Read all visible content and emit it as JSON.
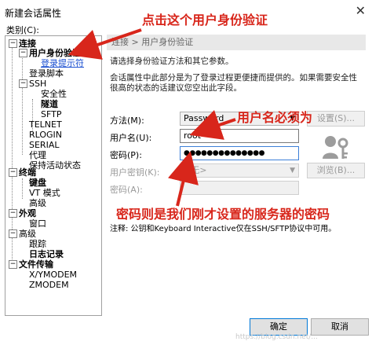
{
  "window": {
    "title": "新建会话属性",
    "close": "✕"
  },
  "tree": {
    "label": "类别(C):",
    "items": [
      {
        "label": "连接",
        "bold": true
      },
      {
        "label": "用户身份验证",
        "bold": true
      },
      {
        "label": "登录提示符",
        "link": true
      },
      {
        "label": "登录脚本"
      },
      {
        "label": "SSH"
      },
      {
        "label": "安全性"
      },
      {
        "label": "隧道",
        "bold": true
      },
      {
        "label": "SFTP"
      },
      {
        "label": "TELNET"
      },
      {
        "label": "RLOGIN"
      },
      {
        "label": "SERIAL"
      },
      {
        "label": "代理"
      },
      {
        "label": "保持活动状态"
      },
      {
        "label": "终端",
        "bold": true
      },
      {
        "label": "键盘",
        "bold": true
      },
      {
        "label": "VT 模式"
      },
      {
        "label": "高级"
      },
      {
        "label": "外观",
        "bold": true
      },
      {
        "label": "窗口"
      },
      {
        "label": "高级"
      },
      {
        "label": "跟踪"
      },
      {
        "label": "日志记录",
        "bold": true
      },
      {
        "label": "文件传输",
        "bold": true
      },
      {
        "label": "X/YMODEM"
      },
      {
        "label": "ZMODEM"
      }
    ]
  },
  "panel": {
    "breadcrumb": "连接 > 用户身份验证",
    "desc1": "请选择身份验证方法和其它参数。",
    "desc2": "会话属性中此部分是为了登录过程更便捷而提供的。如果需要安全性",
    "desc3": "很高的状态的话建议您空出此字段。",
    "method_label": "方法(M):",
    "method_value": "Password",
    "settings_button": "设置(S)...",
    "username_label": "用户名(U):",
    "username_value": "root",
    "password_label": "密码(P):",
    "password_value": "●●●●●●●●●●●●●●",
    "userkey_label": "用户密钥(K):",
    "userkey_value": "<无>",
    "browse_button": "浏览(B)...",
    "passphrase_label": "密码(A):",
    "note": "注释: 公钥和Keyboard Interactive仅在SSH/SFTP协议中可用。"
  },
  "buttons": {
    "ok": "确定",
    "cancel": "取消"
  },
  "annotations": {
    "top": "点击这个用户身份验证",
    "username": "用户名必须为",
    "password": "密码则是我们刚才设置的服务器的密码"
  },
  "watermark": "https://blog.csdn.net/...",
  "colors": {
    "annotation": "#d8261b",
    "link": "#1a4fd1",
    "focus": "#3c7fd8"
  }
}
